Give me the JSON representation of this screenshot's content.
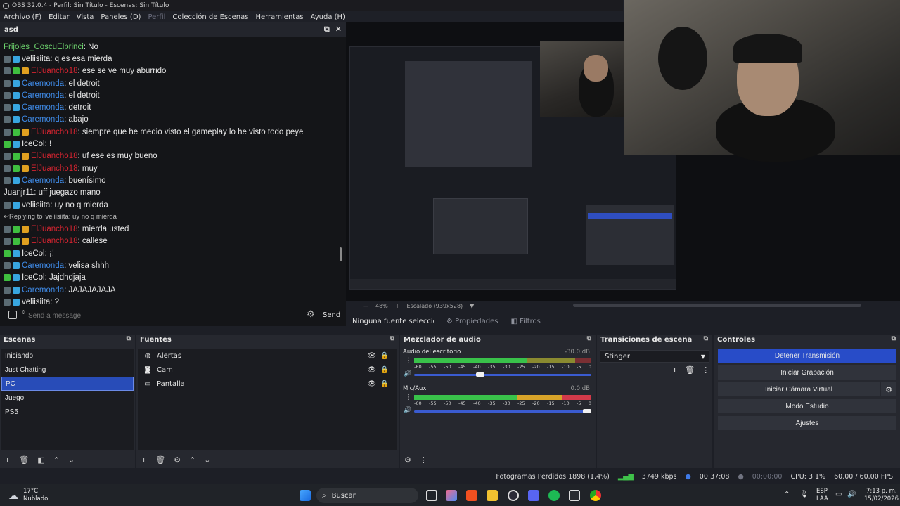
{
  "window": {
    "title": "OBS 32.0.4 - Perfil: Sin Título - Escenas: Sin Título"
  },
  "menu": [
    "Archivo (F)",
    "Editar",
    "Vista",
    "Paneles (D)",
    "Perfil",
    "Colección de Escenas",
    "Herramientas",
    "Ayuda (H)"
  ],
  "chat": {
    "title": "asd",
    "messages": [
      {
        "user": "Frijoles_CoscuElprinci",
        "text": "No",
        "color": "#6dd36d",
        "badges": []
      },
      {
        "user": "veliisiita",
        "text": "q es esa mierda",
        "color": "#e8e8e8",
        "badges": [
          "#5b6b73",
          "#38a6e0"
        ]
      },
      {
        "user": "ElJuancho18",
        "text": "ese se ve muy aburrido",
        "color": "#d42430",
        "badges": [
          "#5b6b73",
          "#3fbf3f",
          "#e0a020"
        ]
      },
      {
        "user": "Caremonda",
        "text": "el detroit",
        "color": "#3f8be8",
        "badges": [
          "#5b6b73",
          "#38a6e0"
        ]
      },
      {
        "user": "Caremonda",
        "text": "el detroit",
        "color": "#3f8be8",
        "badges": [
          "#5b6b73",
          "#38a6e0"
        ]
      },
      {
        "user": "Caremonda",
        "text": "detroit",
        "color": "#3f8be8",
        "badges": [
          "#5b6b73",
          "#38a6e0"
        ]
      },
      {
        "user": "Caremonda",
        "text": "abajo",
        "color": "#3f8be8",
        "badges": [
          "#5b6b73",
          "#38a6e0"
        ]
      },
      {
        "user": "ElJuancho18",
        "text": "siempre que he medio visto el gameplay lo he visto todo peye",
        "color": "#d42430",
        "badges": [
          "#5b6b73",
          "#3fbf3f",
          "#e0a020"
        ]
      },
      {
        "user": "IceCol",
        "text": "!",
        "color": "#e8e8e8",
        "badges": [
          "#3fbf3f",
          "#38a6e0"
        ]
      },
      {
        "user": "ElJuancho18",
        "text": "uf ese es muy bueno",
        "color": "#d42430",
        "badges": [
          "#5b6b73",
          "#3fbf3f",
          "#e0a020"
        ]
      },
      {
        "user": "ElJuancho18",
        "text": "muy",
        "color": "#d42430",
        "badges": [
          "#5b6b73",
          "#3fbf3f",
          "#e0a020"
        ]
      },
      {
        "user": "Caremonda",
        "text": "buenísimo",
        "color": "#3f8be8",
        "badges": [
          "#5b6b73",
          "#38a6e0"
        ]
      },
      {
        "user": "Juanjr11",
        "text": "uff juegazo mano",
        "color": "#e8e8e8",
        "badges": []
      },
      {
        "user": "veliisiita",
        "text": "uy no q mierda",
        "color": "#e8e8e8",
        "badges": [
          "#5b6b73",
          "#38a6e0"
        ]
      },
      {
        "reply": "Replying to",
        "reply_user": "veliisiita",
        "reply_text": ": uy no q mierda"
      },
      {
        "user": "ElJuancho18",
        "text": "mierda usted",
        "color": "#d42430",
        "badges": [
          "#5b6b73",
          "#3fbf3f",
          "#e0a020"
        ]
      },
      {
        "user": "ElJuancho18",
        "text": "callese",
        "color": "#d42430",
        "badges": [
          "#5b6b73",
          "#3fbf3f",
          "#e0a020"
        ]
      },
      {
        "user": "IceCol",
        "text": "¡!",
        "color": "#e8e8e8",
        "badges": [
          "#3fbf3f",
          "#38a6e0"
        ]
      },
      {
        "user": "Caremonda",
        "text": "velisa shhh",
        "color": "#3f8be8",
        "badges": [
          "#5b6b73",
          "#38a6e0"
        ]
      },
      {
        "user": "IceCol",
        "text": "Jajdhdjaja",
        "color": "#e8e8e8",
        "badges": [
          "#3fbf3f",
          "#38a6e0"
        ]
      },
      {
        "user": "Caremonda",
        "text": "JAJAJAJAJA",
        "color": "#3f8be8",
        "badges": [
          "#5b6b73",
          "#38a6e0"
        ]
      },
      {
        "user": "veliisiita",
        "text": "?",
        "color": "#e8e8e8",
        "badges": [
          "#5b6b73",
          "#38a6e0"
        ]
      }
    ],
    "input_placeholder": "Send a message",
    "send_label": "Send"
  },
  "preview": {
    "zoom": "48%",
    "scaling": "Escalado (939x528)",
    "no_source": "Ninguna fuente seleccionada",
    "properties": "Propiedades",
    "filters": "Filtros"
  },
  "scenes": {
    "title": "Escenas",
    "items": [
      "Iniciando",
      "Just Chatting",
      "PC",
      "Juego",
      "PS5"
    ],
    "selected": 2
  },
  "sources": {
    "title": "Fuentes",
    "items": [
      {
        "label": "Alertas",
        "icon": "globe-icon"
      },
      {
        "label": "Cam",
        "icon": "camera-icon"
      },
      {
        "label": "Pantalla",
        "icon": "monitor-icon"
      }
    ]
  },
  "mixer": {
    "title": "Mezclador de audio",
    "tracks": [
      {
        "name": "Audio del escritorio",
        "db": "-30.0 dB",
        "level": 0.37
      },
      {
        "name": "Mic/Aux",
        "db": "0.0 dB",
        "level": 1.0
      }
    ],
    "ticks": [
      "-60",
      "-55",
      "-50",
      "-45",
      "-40",
      "-35",
      "-30",
      "-25",
      "-20",
      "-15",
      "-10",
      "-5",
      "0"
    ]
  },
  "transitions": {
    "title": "Transiciones de escena",
    "selected": "Stinger"
  },
  "controls": {
    "title": "Controles",
    "buttons": [
      "Detener Transmisión",
      "Iniciar Grabación",
      "Iniciar Cámara Virtual",
      "Modo Estudio",
      "Ajustes"
    ]
  },
  "status": {
    "dropped": "Fotogramas Perdidos 1898 (1.4%)",
    "bitrate": "3749 kbps",
    "stream_time": "00:37:08",
    "rec_time": "00:00:00",
    "cpu": "CPU: 3.1%",
    "fps": "60.00 / 60.00 FPS"
  },
  "taskbar": {
    "temp": "17°C",
    "weather": "Nublado",
    "search": "Buscar",
    "lang1": "ESP",
    "lang2": "LAA",
    "time": "7:13 p. m.",
    "date": "15/02/2026"
  }
}
